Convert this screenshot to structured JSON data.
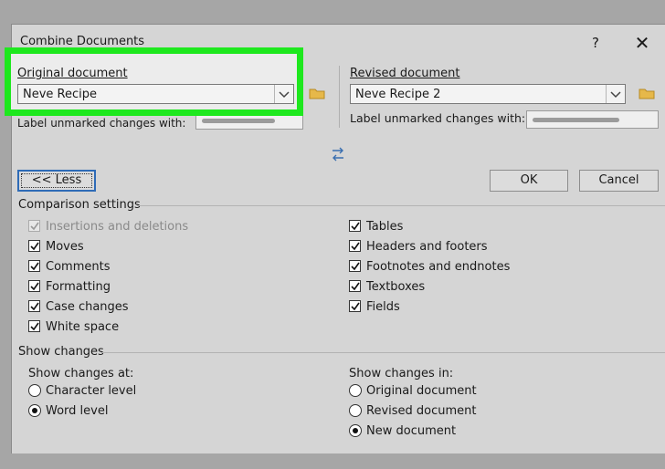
{
  "dialog": {
    "title": "Combine Documents",
    "help_label": "?",
    "close_label": "✕"
  },
  "original": {
    "label": "Original document",
    "value": "Neve Recipe",
    "label_unmarked": "Label unmarked changes with:"
  },
  "revised": {
    "label": "Revised document",
    "value": "Neve Recipe 2",
    "label_unmarked": "Label unmarked changes with:"
  },
  "swap_icon": "swap-arrows-icon",
  "buttons": {
    "less": "<< Less",
    "ok": "OK",
    "cancel": "Cancel"
  },
  "comparison": {
    "heading": "Comparison settings",
    "left": [
      {
        "label": "Insertions and deletions",
        "checked": true,
        "disabled": true
      },
      {
        "label": "Moves",
        "checked": true,
        "disabled": false
      },
      {
        "label": "Comments",
        "checked": true,
        "disabled": false
      },
      {
        "label": "Formatting",
        "checked": true,
        "disabled": false
      },
      {
        "label": "Case changes",
        "checked": true,
        "disabled": false
      },
      {
        "label": "White space",
        "checked": true,
        "disabled": false
      }
    ],
    "right": [
      {
        "label": "Tables",
        "checked": true
      },
      {
        "label": "Headers and footers",
        "checked": true
      },
      {
        "label": "Footnotes and endnotes",
        "checked": true
      },
      {
        "label": "Textboxes",
        "checked": true
      },
      {
        "label": "Fields",
        "checked": true
      }
    ]
  },
  "show_changes": {
    "heading": "Show changes",
    "at_label": "Show changes at:",
    "at_options": [
      {
        "label": "Character level",
        "selected": false
      },
      {
        "label": "Word level",
        "selected": true
      }
    ],
    "in_label": "Show changes in:",
    "in_options": [
      {
        "label": "Original document",
        "selected": false
      },
      {
        "label": "Revised document",
        "selected": false
      },
      {
        "label": "New document",
        "selected": true
      }
    ]
  },
  "colors": {
    "highlight": "#1ee81e",
    "focus_border": "#2e6bb7",
    "dialog_bg": "#d5d5d5",
    "swap_icon": "#3a6fb0"
  }
}
